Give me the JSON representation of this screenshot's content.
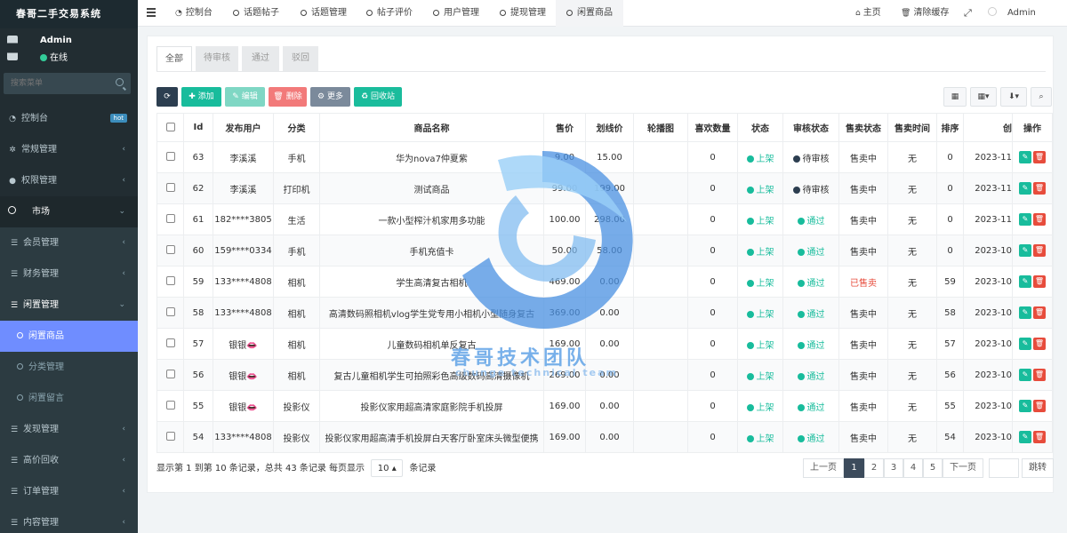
{
  "app": {
    "title": "春哥二手交易系统"
  },
  "user": {
    "name": "Admin",
    "status": "在线"
  },
  "sidebar": {
    "search_placeholder": "搜索菜单",
    "items": [
      {
        "label": "控制台",
        "badge": "hot"
      },
      {
        "label": "常规管理"
      },
      {
        "label": "权限管理"
      },
      {
        "label": "市场"
      },
      {
        "label": "会员管理"
      },
      {
        "label": "财务管理"
      },
      {
        "label": "闲置管理"
      },
      {
        "label": "闲置商品"
      },
      {
        "label": "分类管理"
      },
      {
        "label": "闲置留言"
      },
      {
        "label": "发现管理"
      },
      {
        "label": "高价回收"
      },
      {
        "label": "订单管理"
      },
      {
        "label": "内容管理"
      }
    ]
  },
  "topbar": {
    "tabs": [
      "控制台",
      "话题帖子",
      "话题管理",
      "帖子评价",
      "用户管理",
      "提现管理",
      "闲置商品"
    ],
    "right": {
      "home": "主页",
      "clear_cache": "清除缓存",
      "admin": "Admin"
    }
  },
  "subtabs": [
    "全部",
    "待审核",
    "通过",
    "驳回"
  ],
  "toolbar": {
    "add": "添加",
    "edit": "编辑",
    "delete": "删除",
    "more": "更多",
    "recycle": "回收站"
  },
  "table": {
    "columns": [
      "Id",
      "发布用户",
      "分类",
      "商品名称",
      "售价",
      "划线价",
      "轮播图",
      "喜欢数量",
      "状态",
      "审核状态",
      "售卖状态",
      "售卖时间",
      "排序",
      "创",
      "操作"
    ],
    "rows": [
      {
        "id": "63",
        "user": "李溪溪",
        "cat": "手机",
        "name": "华为nova7仲夏紫",
        "price": "9.00",
        "orig": "15.00",
        "likes": "0",
        "status": "上架",
        "audit": "待审核",
        "sale": "售卖中",
        "time": "无",
        "sort": "0",
        "created": "2023-11"
      },
      {
        "id": "62",
        "user": "李溪溪",
        "cat": "打印机",
        "name": "测试商品",
        "price": "99.00",
        "orig": "199.00",
        "likes": "0",
        "status": "上架",
        "audit": "待审核",
        "sale": "售卖中",
        "time": "无",
        "sort": "0",
        "created": "2023-11"
      },
      {
        "id": "61",
        "user": "182****3805",
        "cat": "生活",
        "name": "一款小型榨汁机家用多功能",
        "price": "100.00",
        "orig": "298.00",
        "likes": "0",
        "status": "上架",
        "audit": "通过",
        "sale": "售卖中",
        "time": "无",
        "sort": "0",
        "created": "2023-11"
      },
      {
        "id": "60",
        "user": "159****0334",
        "cat": "手机",
        "name": "手机充值卡",
        "price": "50.00",
        "orig": "58.00",
        "likes": "0",
        "status": "上架",
        "audit": "通过",
        "sale": "售卖中",
        "time": "无",
        "sort": "0",
        "created": "2023-10"
      },
      {
        "id": "59",
        "user": "133****4808",
        "cat": "相机",
        "name": "学生高清复古相机",
        "price": "469.00",
        "orig": "0.00",
        "likes": "0",
        "status": "上架",
        "audit": "通过",
        "sale": "已售卖",
        "time": "无",
        "sort": "59",
        "created": "2023-10"
      },
      {
        "id": "58",
        "user": "133****4808",
        "cat": "相机",
        "name": "高清数码照相机vlog学生党专用小相机小型随身复古",
        "price": "369.00",
        "orig": "0.00",
        "likes": "0",
        "status": "上架",
        "audit": "通过",
        "sale": "售卖中",
        "time": "无",
        "sort": "58",
        "created": "2023-10"
      },
      {
        "id": "57",
        "user": "银银👄",
        "cat": "相机",
        "name": "儿童数码相机单反复古",
        "price": "169.00",
        "orig": "0.00",
        "likes": "0",
        "status": "上架",
        "audit": "通过",
        "sale": "售卖中",
        "time": "无",
        "sort": "57",
        "created": "2023-10"
      },
      {
        "id": "56",
        "user": "银银👄",
        "cat": "相机",
        "name": "复古儿童相机学生可拍照彩色高级数码高清摄像机",
        "price": "269.00",
        "orig": "0.00",
        "likes": "0",
        "status": "上架",
        "audit": "通过",
        "sale": "售卖中",
        "time": "无",
        "sort": "56",
        "created": "2023-10"
      },
      {
        "id": "55",
        "user": "银银👄",
        "cat": "投影仪",
        "name": "投影仪家用超高清家庭影院手机投屏",
        "price": "169.00",
        "orig": "0.00",
        "likes": "0",
        "status": "上架",
        "audit": "通过",
        "sale": "售卖中",
        "time": "无",
        "sort": "55",
        "created": "2023-10"
      },
      {
        "id": "54",
        "user": "133****4808",
        "cat": "投影仪",
        "name": "投影仪家用超高清手机投屏白天客厅卧室床头微型便携",
        "price": "169.00",
        "orig": "0.00",
        "likes": "0",
        "status": "上架",
        "audit": "通过",
        "sale": "售卖中",
        "time": "无",
        "sort": "54",
        "created": "2023-10"
      }
    ]
  },
  "footer": {
    "info_prefix": "显示第 1 到第 10 条记录，总共 43 条记录 每页显示",
    "page_size": "10",
    "info_suffix": "条记录",
    "prev": "上一页",
    "next": "下一页",
    "pages": [
      "1",
      "2",
      "3",
      "4",
      "5"
    ],
    "jump": "跳转"
  },
  "watermark": {
    "text": "春哥技术团队",
    "sub": "chunge technical team"
  },
  "colors": {
    "sidebar": "#222d32",
    "active": "#6f8dff",
    "green": "#18bc9c",
    "blue_dark": "#2c3e50",
    "gray": "#95a5a6",
    "red": "#e74c3c",
    "red_light": "#f27a7a",
    "teal": "#1abc9c",
    "pager_active": "#3c4b5c"
  }
}
